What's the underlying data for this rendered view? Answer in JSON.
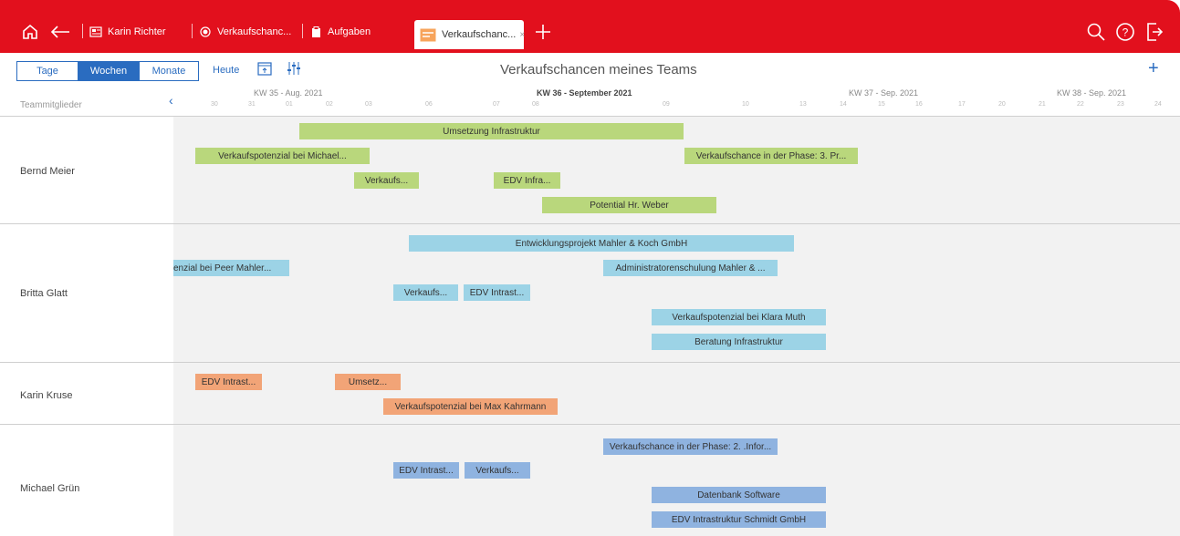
{
  "topbar": {
    "tabs": [
      {
        "label": "Karin Richter"
      },
      {
        "label": "Verkaufschanc..."
      },
      {
        "label": "Aufgaben"
      },
      {
        "label": "Verkaufschanc...",
        "close": "×"
      }
    ]
  },
  "toolbar": {
    "views": [
      "Tage",
      "Wochen",
      "Monate"
    ],
    "today": "Heute",
    "title": "Verkaufschancen meines Teams"
  },
  "timeline": {
    "column_label": "Teammitglieder",
    "weeks": [
      "KW 35 - Aug. 2021",
      "KW 36 - September 2021",
      "KW 37 - Sep. 2021",
      "KW 38 - Sep. 2021"
    ],
    "days": [
      "30",
      "31",
      "01",
      "02",
      "03",
      "06",
      "07",
      "08",
      "09",
      "10",
      "13",
      "14",
      "15",
      "16",
      "17",
      "20",
      "21",
      "22",
      "23",
      "24"
    ]
  },
  "rows": [
    {
      "name": "Bernd Meier",
      "bars": [
        "Umsetzung Infrastruktur",
        "Verkaufspotenzial bei Michael...",
        "Verkaufschance in der Phase: 3. Pr...",
        "Verkaufs...",
        "EDV Infra...",
        "Potential Hr. Weber"
      ]
    },
    {
      "name": "Britta Glatt",
      "bars": [
        "Entwicklungsprojekt Mahler & Koch GmbH",
        "enzial bei Peer Mahler...",
        "Administratorenschulung Mahler & ...",
        "Verkaufs...",
        "EDV Intrast...",
        "Verkaufspotenzial bei Klara Muth",
        "Beratung Infrastruktur"
      ]
    },
    {
      "name": "Karin Kruse",
      "bars": [
        "EDV Intrast...",
        "Umsetz...",
        "Verkaufspotenzial bei Max Kahrmann"
      ]
    },
    {
      "name": "Michael Grün",
      "bars": [
        "Verkaufschance in der Phase: 2. .Infor...",
        "EDV Intrast...",
        "Verkaufs...",
        "Datenbank Software",
        "EDV Intrastruktur Schmidt GmbH"
      ]
    }
  ],
  "colors": {
    "brand": "#e2101d",
    "accent": "#2a6cc0",
    "green": "#b9d77c",
    "blue": "#9cd3e6",
    "orange": "#f2a477",
    "steel": "#8fb3e0"
  }
}
